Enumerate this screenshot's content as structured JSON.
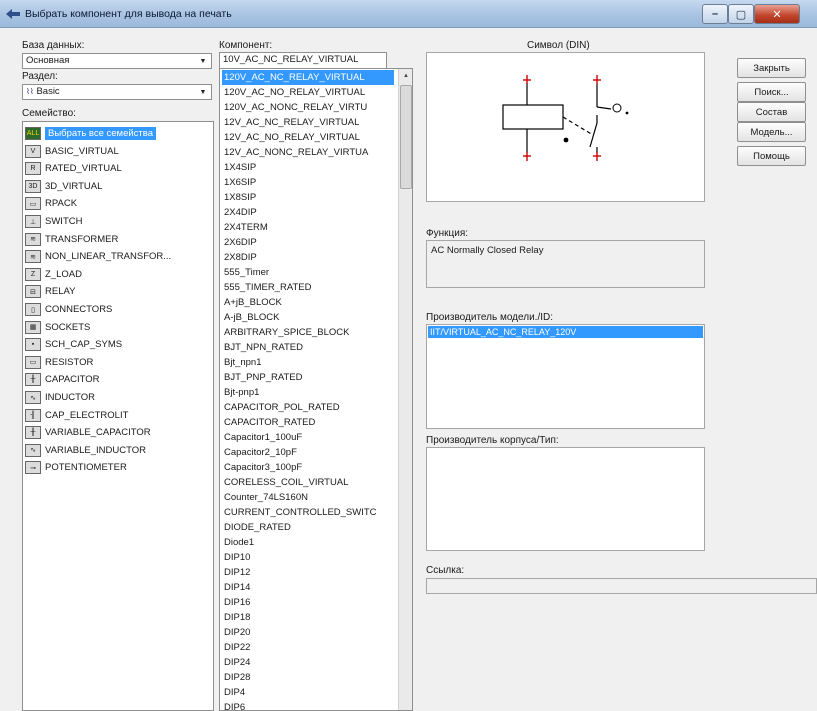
{
  "window": {
    "title": "Выбрать компонент для вывода на печать",
    "min_glyph": "–",
    "max_glyph": "▢",
    "close_glyph": "✕"
  },
  "database": {
    "label": "База данных:",
    "selected": "Основная"
  },
  "group": {
    "label": "Раздел:",
    "selected": "Basic"
  },
  "family": {
    "label": "Семейство:",
    "items": [
      {
        "label": "Выбрать все семейства",
        "icon": "all-families-icon",
        "glyph": "ALL",
        "selected": true
      },
      {
        "label": "BASIC_VIRTUAL",
        "icon": "basic-virtual-icon",
        "glyph": "V"
      },
      {
        "label": "RATED_VIRTUAL",
        "icon": "rated-virtual-icon",
        "glyph": "R"
      },
      {
        "label": "3D_VIRTUAL",
        "icon": "3d-virtual-icon",
        "glyph": "3D"
      },
      {
        "label": "RPACK",
        "icon": "rpack-icon",
        "glyph": "▭"
      },
      {
        "label": "SWITCH",
        "icon": "switch-icon",
        "glyph": "⊥"
      },
      {
        "label": "TRANSFORMER",
        "icon": "transformer-icon",
        "glyph": "≋"
      },
      {
        "label": "NON_LINEAR_TRANSFOR...",
        "icon": "nonlinear-transformer-icon",
        "glyph": "≋"
      },
      {
        "label": "Z_LOAD",
        "icon": "z-load-icon",
        "glyph": "Z"
      },
      {
        "label": "RELAY",
        "icon": "relay-icon",
        "glyph": "⊟"
      },
      {
        "label": "CONNECTORS",
        "icon": "connectors-icon",
        "glyph": "▯"
      },
      {
        "label": "SOCKETS",
        "icon": "sockets-icon",
        "glyph": "▦"
      },
      {
        "label": "SCH_CAP_SYMS",
        "icon": "sch-cap-syms-icon",
        "glyph": "▪"
      },
      {
        "label": "RESISTOR",
        "icon": "resistor-icon",
        "glyph": "▭"
      },
      {
        "label": "CAPACITOR",
        "icon": "capacitor-icon",
        "glyph": "╫"
      },
      {
        "label": "INDUCTOR",
        "icon": "inductor-icon",
        "glyph": "∿"
      },
      {
        "label": "CAP_ELECTROLIT",
        "icon": "cap-electrolit-icon",
        "glyph": "╢"
      },
      {
        "label": "VARIABLE_CAPACITOR",
        "icon": "variable-capacitor-icon",
        "glyph": "╫"
      },
      {
        "label": "VARIABLE_INDUCTOR",
        "icon": "variable-inductor-icon",
        "glyph": "∿"
      },
      {
        "label": "POTENTIOMETER",
        "icon": "potentiometer-icon",
        "glyph": "⊸"
      }
    ]
  },
  "component": {
    "label": "Компонент:",
    "value": "10V_AC_NC_RELAY_VIRTUAL",
    "items": [
      "120V_AC_NC_RELAY_VIRTUAL",
      "120V_AC_NO_RELAY_VIRTUAL",
      "120V_AC_NONC_RELAY_VIRTU",
      "12V_AC_NC_RELAY_VIRTUAL",
      "12V_AC_NO_RELAY_VIRTUAL",
      "12V_AC_NONC_RELAY_VIRTUA",
      "1X4SIP",
      "1X6SIP",
      "1X8SIP",
      "2X4DIP",
      "2X4TERM",
      "2X6DIP",
      "2X8DIP",
      "555_Timer",
      "555_TIMER_RATED",
      "A+jB_BLOCK",
      "A-jB_BLOCK",
      "ARBITRARY_SPICE_BLOCK",
      "BJT_NPN_RATED",
      "Bjt_npn1",
      "BJT_PNP_RATED",
      "Bjt-pnp1",
      "CAPACITOR_POL_RATED",
      "CAPACITOR_RATED",
      "Capacitor1_100uF",
      "Capacitor2_10pF",
      "Capacitor3_100pF",
      "CORELESS_COIL_VIRTUAL",
      "Counter_74LS160N",
      "CURRENT_CONTROLLED_SWITC",
      "DIODE_RATED",
      "Diode1",
      "DIP10",
      "DIP12",
      "DIP14",
      "DIP16",
      "DIP18",
      "DIP20",
      "DIP22",
      "DIP24",
      "DIP28",
      "DIP4",
      "DIP6"
    ]
  },
  "symbol": {
    "label": "Символ (DIN)"
  },
  "function": {
    "label": "Функция:",
    "value": "AC Normally Closed Relay"
  },
  "model_manufacturer": {
    "label": "Производитель модели./ID:",
    "items": [
      "IIT/VIRTUAL_AC_NC_RELAY_120V"
    ]
  },
  "footprint_manufacturer": {
    "label": "Производитель корпуса/Тип:"
  },
  "link": {
    "label": "Ссылка:",
    "value": ""
  },
  "buttons": {
    "close": "Закрыть",
    "search": "Поиск...",
    "detail": "Состав",
    "model": "Модель...",
    "help": "Помощь"
  },
  "colors": {
    "selection": "#3399ff",
    "symbol_red": "#cc0000"
  }
}
